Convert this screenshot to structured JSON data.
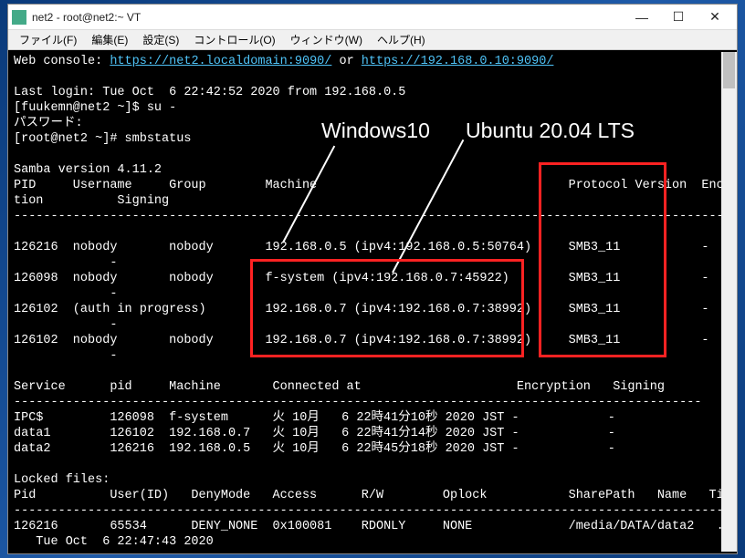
{
  "window": {
    "title": "net2 - root@net2:~ VT"
  },
  "menubar": {
    "items": [
      "ファイル(F)",
      "編集(E)",
      "設定(S)",
      "コントロール(O)",
      "ウィンドウ(W)",
      "ヘルプ(H)"
    ]
  },
  "terminal": {
    "webconsole_prefix": "Web console: ",
    "link1": "https://net2.localdomain:9090/",
    "or": " or ",
    "link2": "https://192.168.0.10:9090/",
    "lastlogin": "Last login: Tue Oct  6 22:42:52 2020 from 192.168.0.5",
    "prompt1": "[fuukemn@net2 ~]$ su -",
    "password": "パスワード:",
    "prompt2": "[root@net2 ~]# smbstatus",
    "samba_ver": "Samba version 4.11.2",
    "hdr1": "PID     Username     Group        Machine                                  Protocol Version  Encryp",
    "hdr1b": "tion          Signing",
    "sep1": "----------------------------------------------------------------------------------------------------",
    "row1": "126216  nobody       nobody       192.168.0.5 (ipv4:192.168.0.5:50764)     SMB3_11           -",
    "row1b": "             -",
    "row2": "126098  nobody       nobody       f-system (ipv4:192.168.0.7:45922)        SMB3_11           -",
    "row2b": "             -",
    "row3": "126102  (auth in progress)        192.168.0.7 (ipv4:192.168.0.7:38992)     SMB3_11           -",
    "row3b": "             -",
    "row4": "126102  nobody       nobody       192.168.0.7 (ipv4:192.168.0.7:38992)     SMB3_11           -",
    "row4b": "             -",
    "svc_hdr": "Service      pid     Machine       Connected at                     Encryption   Signing",
    "sep2": "---------------------------------------------------------------------------------------------",
    "svc1": "IPC$         126098  f-system      火 10月   6 22時41分10秒 2020 JST -            -",
    "svc2": "data1        126102  192.168.0.7   火 10月   6 22時41分14秒 2020 JST -            -",
    "svc3": "data2        126216  192.168.0.5   火 10月   6 22時45分18秒 2020 JST -            -",
    "locked": "Locked files:",
    "lock_hdr": "Pid          User(ID)   DenyMode   Access      R/W        Oplock           SharePath   Name   Time",
    "sep3": "--------------------------------------------------------------------------------------------------",
    "lock1": "126216       65534      DENY_NONE  0x100081    RDONLY     NONE             /media/DATA/data2   .",
    "lock1b": "   Tue Oct  6 22:47:43 2020"
  },
  "annotations": {
    "win10": "Windows10",
    "ubuntu": "Ubuntu 20.04 LTS"
  }
}
